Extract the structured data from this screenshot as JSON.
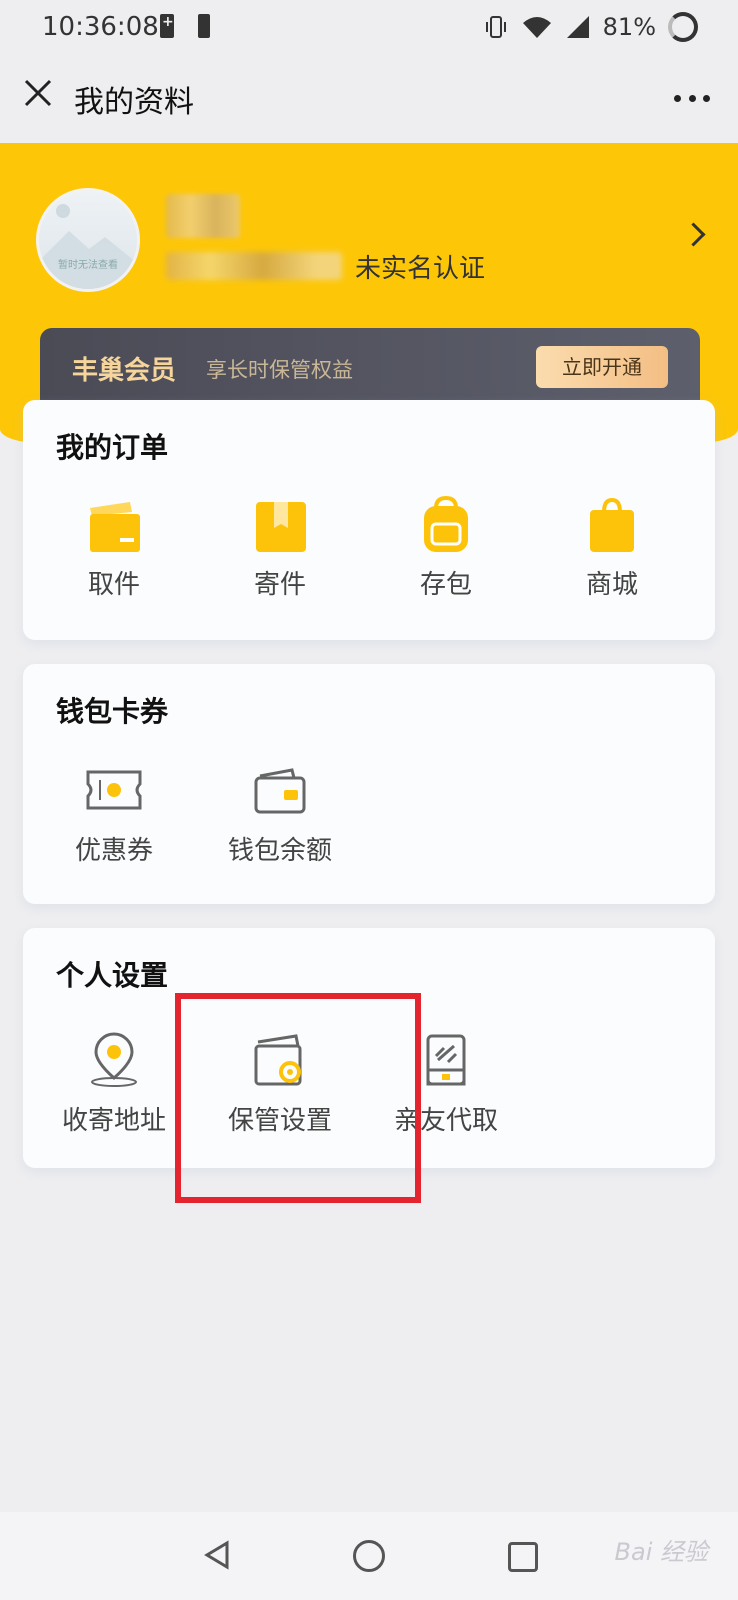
{
  "status_bar": {
    "time": "10:36:08",
    "battery_percent": "81%"
  },
  "header": {
    "title": "我的资料"
  },
  "profile": {
    "avatar_caption": "暂时无法查看",
    "verification_status": "未实名认证"
  },
  "vip": {
    "title": "丰巢会员",
    "subtitle": "享长时保管权益",
    "button_label": "立即开通"
  },
  "orders": {
    "title": "我的订单",
    "items": [
      {
        "label": "取件",
        "icon": "pickup-box-icon"
      },
      {
        "label": "寄件",
        "icon": "send-package-icon"
      },
      {
        "label": "存包",
        "icon": "backpack-storage-icon"
      },
      {
        "label": "商城",
        "icon": "shopping-bag-icon"
      }
    ]
  },
  "wallet": {
    "title": "钱包卡券",
    "items": [
      {
        "label": "优惠券",
        "icon": "coupon-icon"
      },
      {
        "label": "钱包余额",
        "icon": "wallet-icon"
      }
    ]
  },
  "settings": {
    "title": "个人设置",
    "items": [
      {
        "label": "收寄地址",
        "icon": "location-pin-icon"
      },
      {
        "label": "保管设置",
        "icon": "storage-settings-icon"
      },
      {
        "label": "亲友代取",
        "icon": "link-phone-icon"
      }
    ]
  },
  "watermark": "Bai 经验",
  "colors": {
    "brand_yellow": "#fdc708",
    "vip_dark": "#4b4b56",
    "highlight_red": "#e4242f"
  }
}
